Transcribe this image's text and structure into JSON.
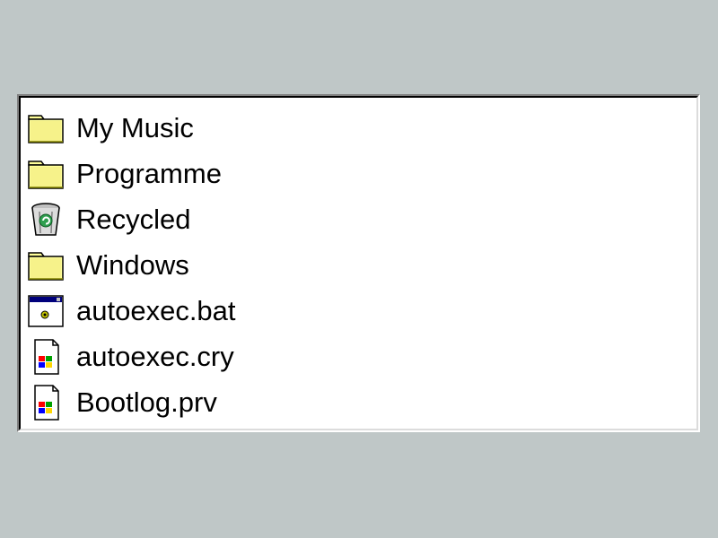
{
  "file_list": {
    "items": [
      {
        "label": "My Music",
        "icon": "folder-icon"
      },
      {
        "label": "Programme",
        "icon": "folder-icon"
      },
      {
        "label": "Recycled",
        "icon": "recycle-bin-icon"
      },
      {
        "label": "Windows",
        "icon": "folder-icon"
      },
      {
        "label": "autoexec.bat",
        "icon": "batch-file-icon"
      },
      {
        "label": "autoexec.cry",
        "icon": "windows-file-icon"
      },
      {
        "label": "Bootlog.prv",
        "icon": "windows-file-icon"
      }
    ]
  },
  "colors": {
    "background": "#bfc7c7",
    "list_background": "#ffffff",
    "folder_fill": "#ffff99",
    "text": "#000000"
  }
}
